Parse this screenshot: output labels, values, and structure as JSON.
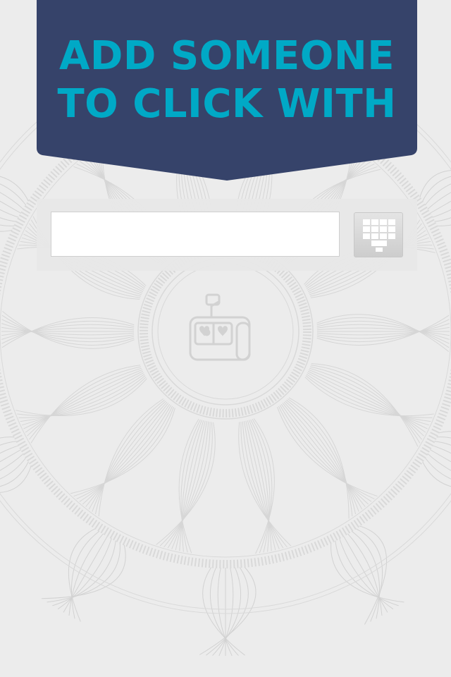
{
  "header": {
    "title_line1": "ADD SOMEONE",
    "title_line2": "TO CLICK WITH",
    "background_color": "#36436a",
    "title_color": "#00a9c6"
  },
  "search": {
    "input_value": "",
    "input_placeholder": "",
    "keypad_icon": "keypad-icon"
  },
  "background": {
    "emblem_icon": "slot-machine-hearts-icon",
    "pattern": "guilloche-rosette"
  }
}
